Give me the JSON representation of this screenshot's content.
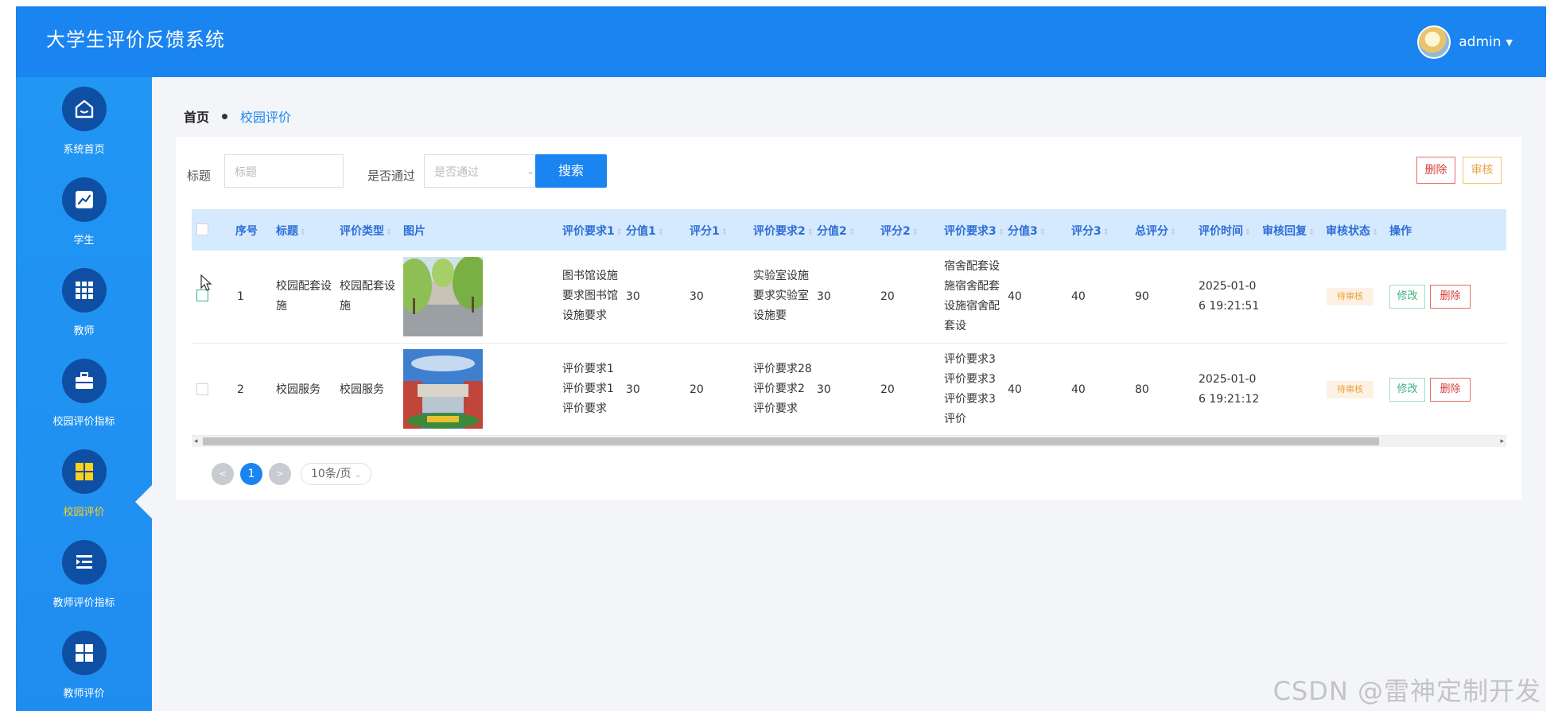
{
  "app": {
    "title": "大学生评价反馈系统",
    "user": "admin"
  },
  "sidebar": {
    "items": [
      {
        "label": "系统首页",
        "icon": "home-icon"
      },
      {
        "label": "学生",
        "icon": "chart-icon"
      },
      {
        "label": "教师",
        "icon": "grid-icon"
      },
      {
        "label": "校园评价指标",
        "icon": "briefcase-icon"
      },
      {
        "label": "校园评价",
        "icon": "apps-icon",
        "active": true
      },
      {
        "label": "教师评价指标",
        "icon": "list-icon"
      },
      {
        "label": "教师评价",
        "icon": "apps-icon"
      }
    ]
  },
  "breadcrumb": {
    "home": "首页",
    "current": "校园评价"
  },
  "filters": {
    "title_label": "标题",
    "title_placeholder": "标题",
    "pass_label": "是否通过",
    "pass_placeholder": "是否通过",
    "search_label": "搜索",
    "delete_label": "删除",
    "audit_label": "审核"
  },
  "table": {
    "columns": [
      "序号",
      "标题",
      "评价类型",
      "图片",
      "评价要求1",
      "分值1",
      "评分1",
      "评价要求2",
      "分值2",
      "评分2",
      "评价要求3",
      "分值3",
      "评分3",
      "总评分",
      "评价时间",
      "审核回复",
      "审核状态",
      "操作"
    ],
    "rows": [
      {
        "index": "1",
        "title": [
          "校园配套设",
          "施"
        ],
        "type": [
          "校园配套设",
          "施"
        ],
        "req1": [
          "图书馆设施",
          "要求图书馆",
          "设施要求"
        ],
        "score_val1": "30",
        "score1": "30",
        "req2": [
          "实验室设施",
          "要求实验室",
          "设施要"
        ],
        "score_val2": "30",
        "score2": "20",
        "req3": [
          "宿舍配套设",
          "施宿舍配套",
          "设施宿舍配",
          "套设"
        ],
        "score_val3": "40",
        "score3": "40",
        "total": "90",
        "time": [
          "2025-01-0",
          "6 19:21:51"
        ],
        "reply": "",
        "status": "待审核",
        "edit": "修改",
        "delete": "删除"
      },
      {
        "index": "2",
        "title": [
          "校园服务"
        ],
        "type": [
          "校园服务"
        ],
        "req1": [
          "评价要求1",
          "评价要求1",
          "评价要求"
        ],
        "score_val1": "30",
        "score1": "20",
        "req2": [
          "评价要求28",
          "评价要求2",
          "评价要求"
        ],
        "score_val2": "30",
        "score2": "20",
        "req3": [
          "评价要求3",
          "评价要求3",
          "评价要求3",
          "评价"
        ],
        "score_val3": "40",
        "score3": "40",
        "total": "80",
        "time": [
          "2025-01-0",
          "6 19:21:12"
        ],
        "reply": "",
        "status": "待审核",
        "edit": "修改",
        "delete": "删除"
      }
    ]
  },
  "pagination": {
    "current": "1",
    "page_size": "10条/页",
    "prev": "<",
    "next": ">"
  },
  "watermark": "CSDN @雷神定制开发",
  "colors": {
    "primary": "#1a84f0",
    "sidebar_active": "#ffd21a",
    "danger": "#d93b3b",
    "warning": "#e6a23c",
    "success": "#3bb07b"
  }
}
